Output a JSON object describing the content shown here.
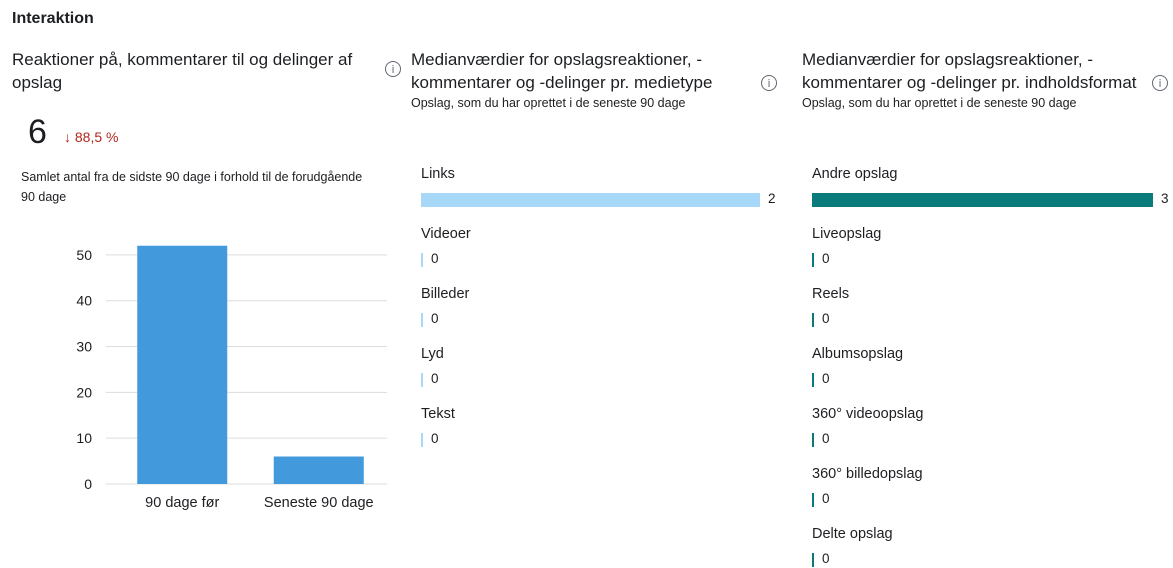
{
  "section_title": "Interaktion",
  "card1": {
    "title": "Reaktioner på, kommentarer til og delinger af opslag",
    "kpi_value": "6",
    "kpi_delta": "↓ 88,5 %",
    "description": "Samlet antal fra de sidste 90 dage i forhold til de forudgående 90 dage"
  },
  "card2": {
    "title": "Medianværdier for opslagsreaktioner, -kommentarer og -delinger pr. medietype",
    "subtitle": "Opslag, som du har oprettet i de seneste 90 dage"
  },
  "card3": {
    "title": "Medianværdier for opslagsreaktioner, -kommentarer og -delinger pr. indholdsformat",
    "subtitle": "Opslag, som du har oprettet i de seneste 90 dage"
  },
  "info_icon": "info-circle-icon",
  "colors": {
    "bar_blue": "#4299db",
    "light_blue": "#a7d8f7",
    "teal": "#0a7a7a",
    "down_red": "#b3261e"
  },
  "chart_data": [
    {
      "type": "bar",
      "categories": [
        "90 dage før",
        "Seneste 90 dage"
      ],
      "values": [
        52,
        6
      ],
      "ylim": [
        0,
        55
      ],
      "yticks": [
        0,
        10,
        20,
        30,
        40,
        50
      ],
      "grid": true,
      "title": "",
      "xlabel": "",
      "ylabel": ""
    },
    {
      "type": "bar",
      "orientation": "horizontal",
      "categories": [
        "Links",
        "Videoer",
        "Billeder",
        "Lyd",
        "Tekst"
      ],
      "values": [
        2,
        0,
        0,
        0,
        0
      ],
      "xlim": [
        0,
        2
      ]
    },
    {
      "type": "bar",
      "orientation": "horizontal",
      "categories": [
        "Andre opslag",
        "Liveopslag",
        "Reels",
        "Albumsopslag",
        "360° videoopslag",
        "360° billedopslag",
        "Delte opslag"
      ],
      "values": [
        3,
        0,
        0,
        0,
        0,
        0,
        0
      ],
      "xlim": [
        0,
        3
      ]
    }
  ]
}
